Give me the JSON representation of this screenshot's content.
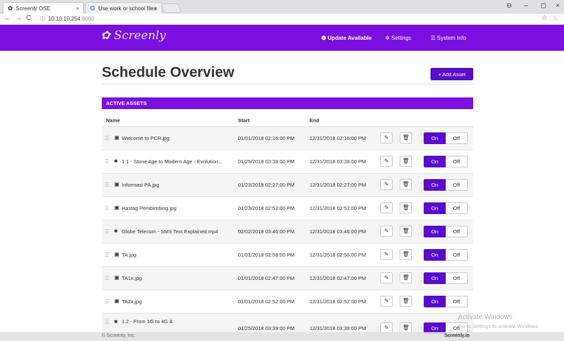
{
  "browser": {
    "tabs": [
      {
        "title": "Screenly OSE",
        "close": "×"
      },
      {
        "title": "Use work or school files",
        "close": "×"
      }
    ],
    "url_host": "10.10.10.254",
    "url_port": ":8080"
  },
  "nav": {
    "logo": "Screenly",
    "update": "Update Available",
    "settings": "Settings",
    "system_info": "System Info"
  },
  "page": {
    "title": "Schedule Overview",
    "add_asset": "+ Add Asset",
    "section": "ACTIVE ASSETS",
    "col_name": "Name",
    "col_start": "Start",
    "col_end": "End",
    "on_label": "On",
    "off_label": "Off"
  },
  "assets": [
    {
      "name": "Welcome to PCR.jpg",
      "type": "image",
      "start": "01/01/2018 02:16:00 PM",
      "end": "12/31/2018 02:16:00 PM"
    },
    {
      "name": "1.1 - Stone Age to Modern Age - Evolution...",
      "type": "video",
      "start": "01/25/2018 03:39:00 PM",
      "end": "12/31/2018 03:39:00 PM"
    },
    {
      "name": "Informasi PA.jpg",
      "type": "image",
      "start": "01/23/2018 02:27:00 PM",
      "end": "12/31/2018 02:27:00 PM"
    },
    {
      "name": "Hastag Pembimbing.jpg",
      "type": "image",
      "start": "01/23/2018 02:52:00 PM",
      "end": "12/31/2018 02:52:00 PM"
    },
    {
      "name": "Globe Telecom - SMS Text Explained.mp4",
      "type": "video",
      "start": "02/02/2018 03:46:00 PM",
      "end": "12/31/2018 03:46:00 PM"
    },
    {
      "name": "TA.jpg",
      "type": "image",
      "start": "01/01/2018 02:56:00 PM",
      "end": "12/31/2018 02:56:00 PM"
    },
    {
      "name": "TA1x.jpg",
      "type": "image",
      "start": "01/01/2018 02:47:00 PM",
      "end": "12/31/2018 02:47:00 PM"
    },
    {
      "name": "TA2x.jpg",
      "type": "image",
      "start": "01/01/2018 02:52:00 PM",
      "end": "12/31/2018 02:52:00 PM"
    }
  ],
  "last_asset": {
    "name_line1": "1.2 - From 1G to 4G &",
    "start": "01/25/2018 03:39:00 PM",
    "end": "12/31/2018 03:39:00 PM"
  },
  "footer": {
    "left": "© Screenly, Inc.",
    "right": "Screenly.io"
  },
  "watermark": {
    "line1": "Activate Windows",
    "line2": "Go to Settings to activate Windows."
  },
  "colors": {
    "accent": "#7a0fe0",
    "button": "#5a0bcf"
  }
}
